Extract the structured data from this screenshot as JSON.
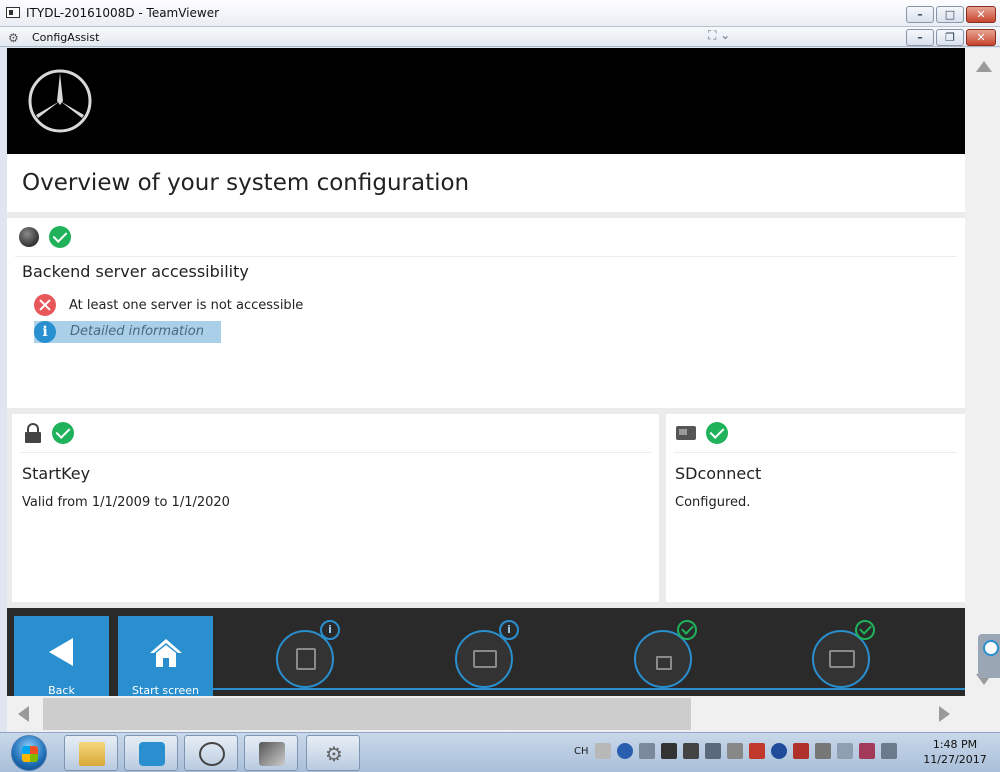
{
  "window": {
    "title": "ITYDL-20161008D - TeamViewer",
    "inner_title": "ConfigAssist"
  },
  "page": {
    "title": "Overview of your system configuration"
  },
  "backend": {
    "heading": "Backend server accessibility",
    "status_text": "At least one server is not accessible",
    "info_link": "Detailed information",
    "info_glyph": "i"
  },
  "startkey": {
    "heading": "StartKey",
    "detail": "Valid from 1/1/2009 to 1/1/2020"
  },
  "sdconnect": {
    "heading": "SDconnect",
    "detail": "Configured."
  },
  "footer": {
    "back_label": "Back",
    "start_label": "Start screen",
    "badge_info": "i"
  },
  "taskbar": {
    "lang": "CH",
    "time": "1:48 PM",
    "date": "11/27/2017"
  },
  "colors": {
    "accent": "#2a8fcf",
    "ok": "#1fb25a",
    "error": "#e8575a",
    "header_bg": "#000000",
    "footer_bg": "#2a2a2a"
  },
  "icons": {
    "backend": "globe-icon",
    "startkey": "lock-icon",
    "sdconnect": "device-icon",
    "status_ok": "check-circle-icon",
    "status_error": "x-circle-icon",
    "info": "info-circle-icon"
  }
}
